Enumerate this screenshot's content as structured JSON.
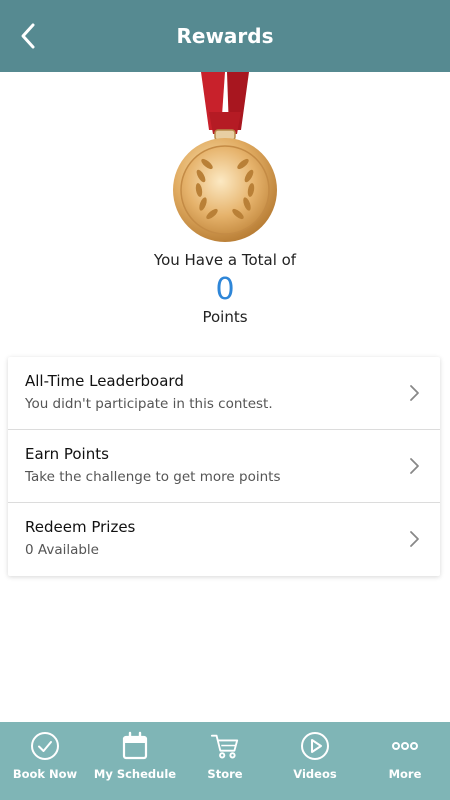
{
  "header": {
    "title": "Rewards"
  },
  "summary": {
    "total_label": "You Have a Total of",
    "points": "0",
    "points_label": "Points"
  },
  "menu": {
    "items": [
      {
        "title": "All-Time Leaderboard",
        "subtitle": "You didn't participate in this contest."
      },
      {
        "title": "Earn Points",
        "subtitle": "Take the challenge to get more points"
      },
      {
        "title": "Redeem Prizes",
        "subtitle": "0 Available"
      }
    ]
  },
  "tabbar": {
    "items": [
      {
        "label": "Book Now",
        "icon": "check-circle-icon"
      },
      {
        "label": "My Schedule",
        "icon": "calendar-icon"
      },
      {
        "label": "Store",
        "icon": "cart-icon"
      },
      {
        "label": "Videos",
        "icon": "play-circle-icon"
      },
      {
        "label": "More",
        "icon": "more-dots-icon"
      }
    ]
  },
  "colors": {
    "header_bg": "#568a91",
    "tabbar_bg": "#7fb5b6",
    "points_blue": "#2e86d8",
    "ribbon_red": "#c8212b",
    "medal_gold": "#d9a35c"
  }
}
